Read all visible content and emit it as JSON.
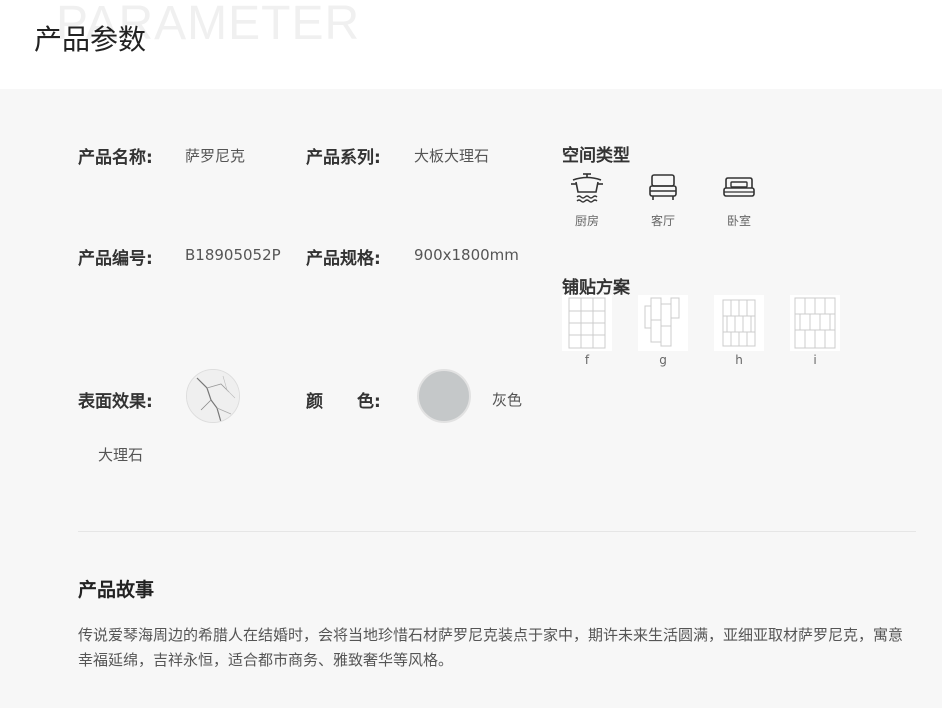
{
  "header": {
    "bg_word": "PARAMETER",
    "title": "产品参数"
  },
  "params": {
    "name_label": "产品名称:",
    "name_value": "萨罗尼克",
    "series_label": "产品系列:",
    "series_value": "大板大理石",
    "code_label": "产品编号:",
    "code_value": "B18905052P",
    "spec_label": "产品规格:",
    "spec_value": "900x1800mm",
    "surface_label": "表面效果:",
    "surface_value": "大理石",
    "color_label": "颜　　色:",
    "color_value": "灰色",
    "color_swatch": "#c5c8c9"
  },
  "space": {
    "title": "空间类型",
    "items": [
      {
        "label": "厨房",
        "icon": "kitchen-pot-icon"
      },
      {
        "label": "客厅",
        "icon": "sofa-icon"
      },
      {
        "label": "卧室",
        "icon": "bed-icon"
      }
    ]
  },
  "layout": {
    "title": "铺贴方案",
    "items": [
      {
        "label": "f"
      },
      {
        "label": "g"
      },
      {
        "label": "h"
      },
      {
        "label": "i"
      }
    ]
  },
  "story": {
    "title": "产品故事",
    "text": "传说爱琴海周边的希腊人在结婚时，会将当地珍惜石材萨罗尼克装点于家中，期许未来生活圆满，亚细亚取材萨罗尼克，寓意幸福延绵，吉祥永恒，适合都市商务、雅致奢华等风格。"
  }
}
